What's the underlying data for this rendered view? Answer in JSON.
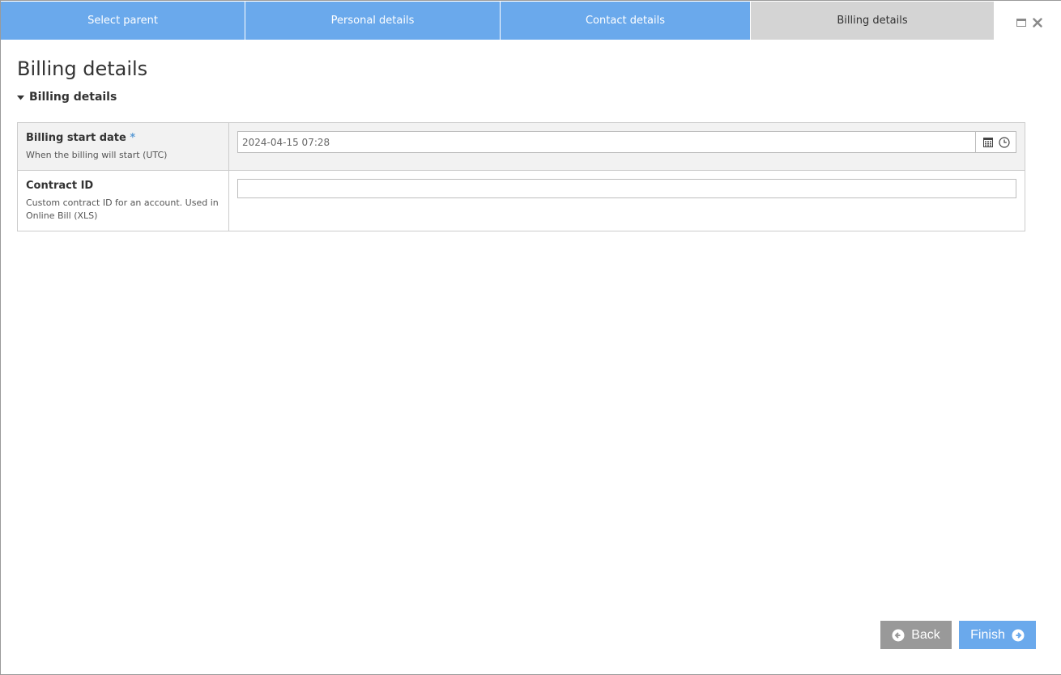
{
  "tabs": [
    {
      "label": "Select parent",
      "active": false
    },
    {
      "label": "Personal details",
      "active": false
    },
    {
      "label": "Contact details",
      "active": false
    },
    {
      "label": "Billing details",
      "active": true
    }
  ],
  "window_controls": {
    "maximize_icon": "maximize-icon",
    "close_icon": "close-icon"
  },
  "page": {
    "title": "Billing details"
  },
  "section": {
    "title": "Billing details",
    "expanded": true,
    "toggle_icon": "caret-down-icon"
  },
  "fields": [
    {
      "label": "Billing start date",
      "required_marker": "*",
      "description": "When the billing will start (UTC)",
      "value": "2024-04-15 07:28",
      "placeholder": "",
      "icons": [
        "calendar-icon",
        "clock-icon"
      ]
    },
    {
      "label": "Contract ID",
      "required_marker": "",
      "description": "Custom contract ID for an account. Used in Online Bill (XLS)",
      "value": "",
      "placeholder": ""
    }
  ],
  "buttons": {
    "back": {
      "label": "Back",
      "icon": "arrow-left-circle-icon"
    },
    "finish": {
      "label": "Finish",
      "icon": "arrow-right-circle-icon"
    }
  },
  "colors": {
    "tab_inactive": "#6aa9ec",
    "tab_active": "#d4d4d4",
    "required": "#5b9bd5",
    "back_button": "#999999",
    "finish_button": "#6aa9ec"
  }
}
